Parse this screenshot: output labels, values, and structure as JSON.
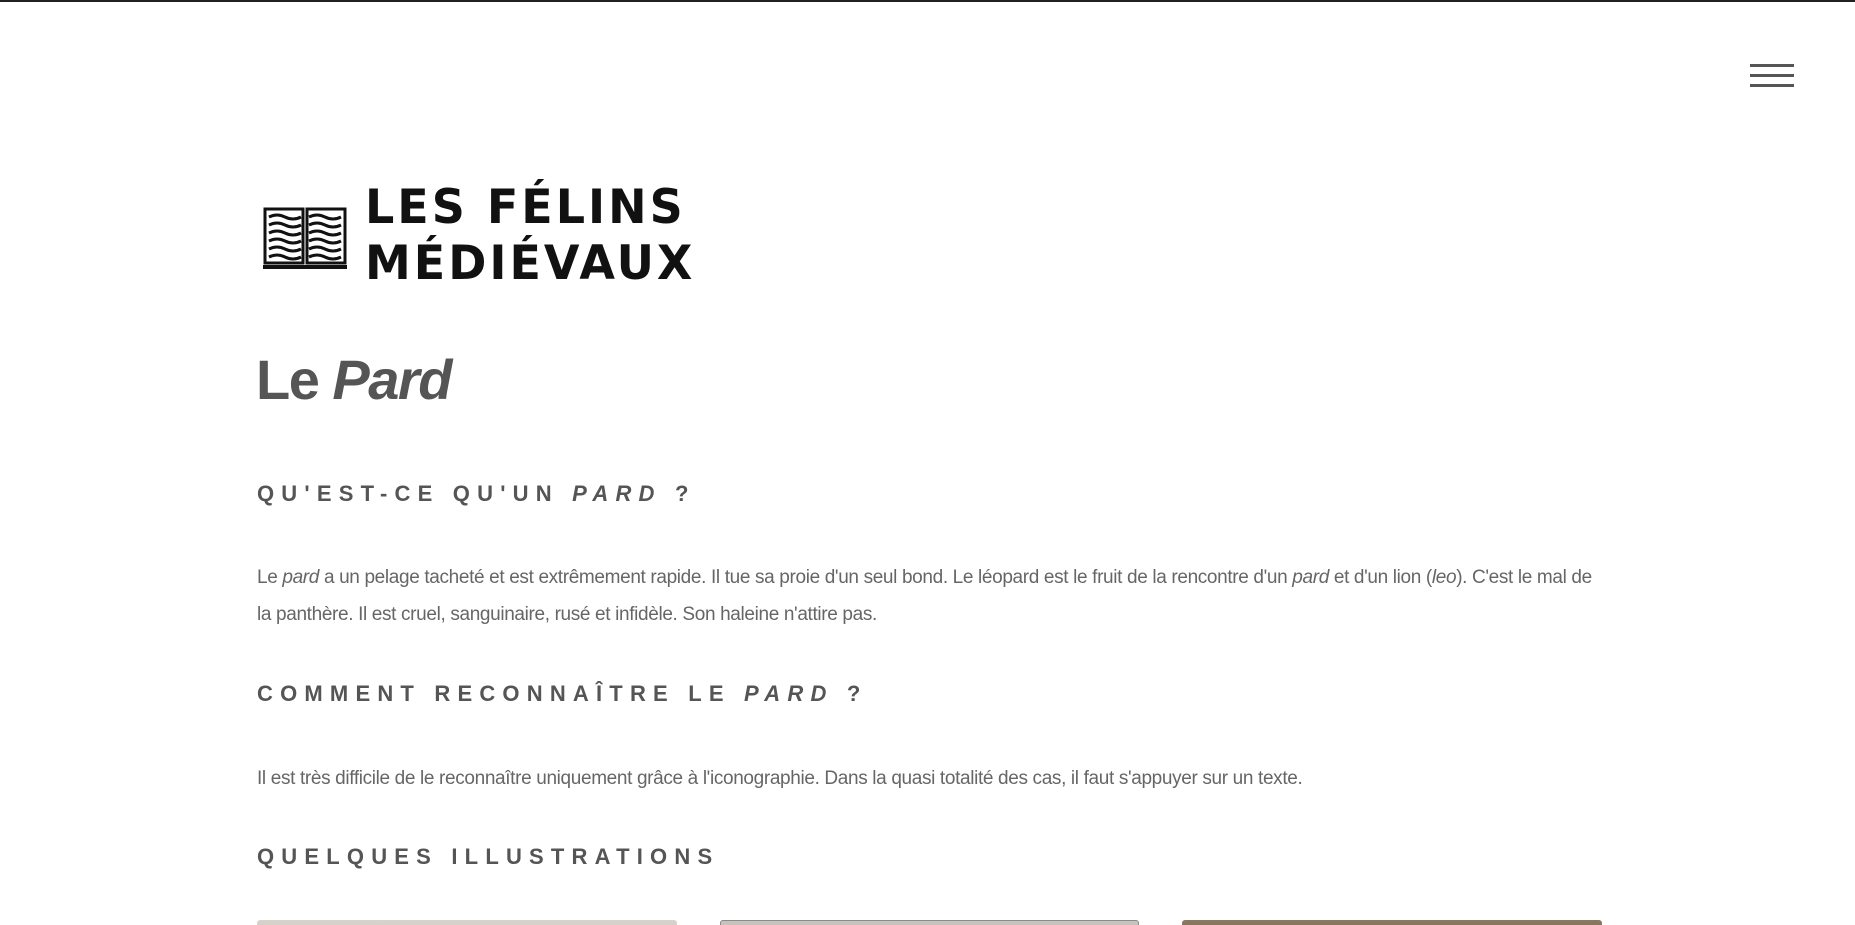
{
  "header": {
    "menu_icon": "hamburger-menu-icon",
    "logo": {
      "icon": "open-book-icon",
      "line1": "LES FÉLINS",
      "line2": "MÉDIÉVAUX"
    }
  },
  "main": {
    "title_prefix": "Le",
    "title_emphasis": "Pard",
    "sections": [
      {
        "heading_prefix": "QU'EST-CE QU'UN",
        "heading_emphasis": "PARD",
        "heading_suffix": "?",
        "text_parts": [
          "Le ",
          "pard",
          " a un pelage tacheté et est extrêmement rapide. Il tue sa proie d'un seul bond. Le léopard est le fruit de la rencontre d'un ",
          "pard",
          " et d'un lion (",
          "leo",
          "). C'est le mal de la panthère. Il est cruel, sanguinaire, rusé et infidèle. Son haleine n'attire pas."
        ]
      },
      {
        "heading_prefix": "COMMENT RECONNAÎTRE LE",
        "heading_emphasis": "PARD",
        "heading_suffix": "?",
        "text": "Il est très difficile de le reconnaître uniquement grâce à l'iconographie. Dans la quasi totalité des cas, il faut s'appuyer sur un texte."
      },
      {
        "heading": "QUELQUES ILLUSTRATIONS"
      }
    ],
    "gallery_count": 3
  }
}
